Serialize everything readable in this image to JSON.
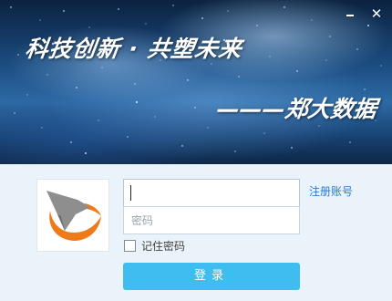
{
  "window": {
    "minimize_icon": "minimize-icon",
    "close_icon": "close-icon",
    "close_glyph": "✕"
  },
  "banner": {
    "slogan": "科技创新 · 共塑未来",
    "signature": "———郑大数据"
  },
  "login": {
    "username_value": "",
    "username_placeholder": "",
    "password_placeholder": "密码",
    "register_label": "注册账号",
    "remember_label": "记住密码",
    "remember_checked": false,
    "login_label": "登录"
  },
  "colors": {
    "accent": "#3fbdf0",
    "link": "#2a7ad0",
    "logo_gray": "#8e8e8e",
    "logo_orange": "#ee7a1a",
    "background": "#eaf2fa"
  },
  "logo": {
    "icon": "orange-swoosh-logo"
  }
}
